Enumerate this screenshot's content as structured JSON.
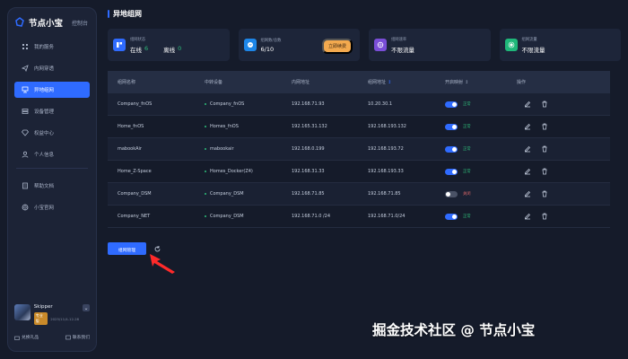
{
  "app": {
    "name": "节点小宝",
    "console_label": "控制台"
  },
  "colors": {
    "accent": "#2f6bff",
    "online": "#2ebd7a",
    "offline": "#e66b6b",
    "renew": "#f3a94e"
  },
  "sidebar": {
    "items": [
      {
        "label": "我的服务",
        "icon": "grid-icon"
      },
      {
        "label": "内网穿透",
        "icon": "send-icon"
      },
      {
        "label": "异地组网",
        "icon": "network-icon",
        "active": true
      },
      {
        "label": "设备管理",
        "icon": "device-icon"
      },
      {
        "label": "权益中心",
        "icon": "diamond-icon"
      },
      {
        "label": "个人信息",
        "icon": "user-icon"
      }
    ],
    "items2": [
      {
        "label": "帮助文档",
        "icon": "doc-icon"
      },
      {
        "label": "小宝官网",
        "icon": "globe-icon"
      }
    ],
    "user": {
      "name": "Skipper",
      "badge": "专业版",
      "date": "2025/11/4-12-28",
      "links": [
        "兑换礼品",
        "联系我们"
      ]
    }
  },
  "page": {
    "title": "异地组网"
  },
  "cards": [
    {
      "label": "组网状态",
      "online_label": "在线",
      "online_count": "6",
      "offline_label": "离线",
      "offline_count": "0"
    },
    {
      "label": "组网数/总数",
      "value": "6/10",
      "button": "立即续费"
    },
    {
      "label": "组网速率",
      "value": "不限流量"
    },
    {
      "label": "组网流量",
      "value": "不限流量"
    }
  ],
  "table": {
    "headers": [
      "组网名称",
      "中转设备",
      "内网地址",
      "组网地址",
      "开启映射",
      "操作"
    ],
    "rows": [
      {
        "name": "Company_fnOS",
        "device": "Company_fnOS",
        "lan": "192.168.71.93",
        "net": "10.20.30.1",
        "on": true,
        "status": "正常"
      },
      {
        "name": "Home_fnOS",
        "device": "Homes_fnOS",
        "lan": "192.165.31.132",
        "net": "192.168.193.132",
        "on": true,
        "status": "正常"
      },
      {
        "name": "mabookAir",
        "device": "mabookair",
        "lan": "192.168.0.199",
        "net": "192.168.193.72",
        "on": true,
        "status": "正常"
      },
      {
        "name": "Home_Z-Space",
        "device": "Homes_Docker(Z4)",
        "lan": "192.168.31.33",
        "net": "192.168.193.33",
        "on": true,
        "status": "正常"
      },
      {
        "name": "Company_DSM",
        "device": "Company_DSM",
        "lan": "192.168.71.85",
        "net": "192.168.71.85",
        "on": false,
        "status": "关闭"
      },
      {
        "name": "Company_NET",
        "device": "Company_DSM",
        "lan": "192.168.71.0 /24",
        "net": "192.168.71.0/24",
        "on": true,
        "status": "正常"
      }
    ]
  },
  "actions": {
    "manage_button": "组网管理"
  },
  "watermark": "掘金技术社区 @ 节点小宝"
}
